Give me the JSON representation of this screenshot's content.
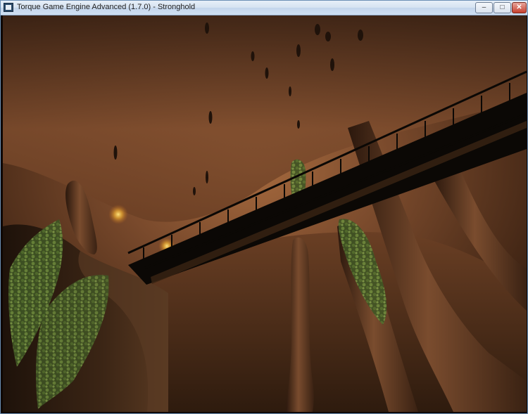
{
  "window": {
    "title": "Torque Game Engine Advanced (1.7.0) - Stronghold",
    "controls": {
      "minimize": "‒",
      "maximize": "□",
      "close": "✕"
    }
  },
  "scene": {
    "icons": [
      "app-icon",
      "minimize-icon",
      "maximize-icon",
      "close-icon"
    ],
    "accent_colors": {
      "rock": "#7a4a2c",
      "torch": "#f0c040",
      "foliage": "#4f6b2e",
      "bridge": "#0b0805"
    }
  }
}
